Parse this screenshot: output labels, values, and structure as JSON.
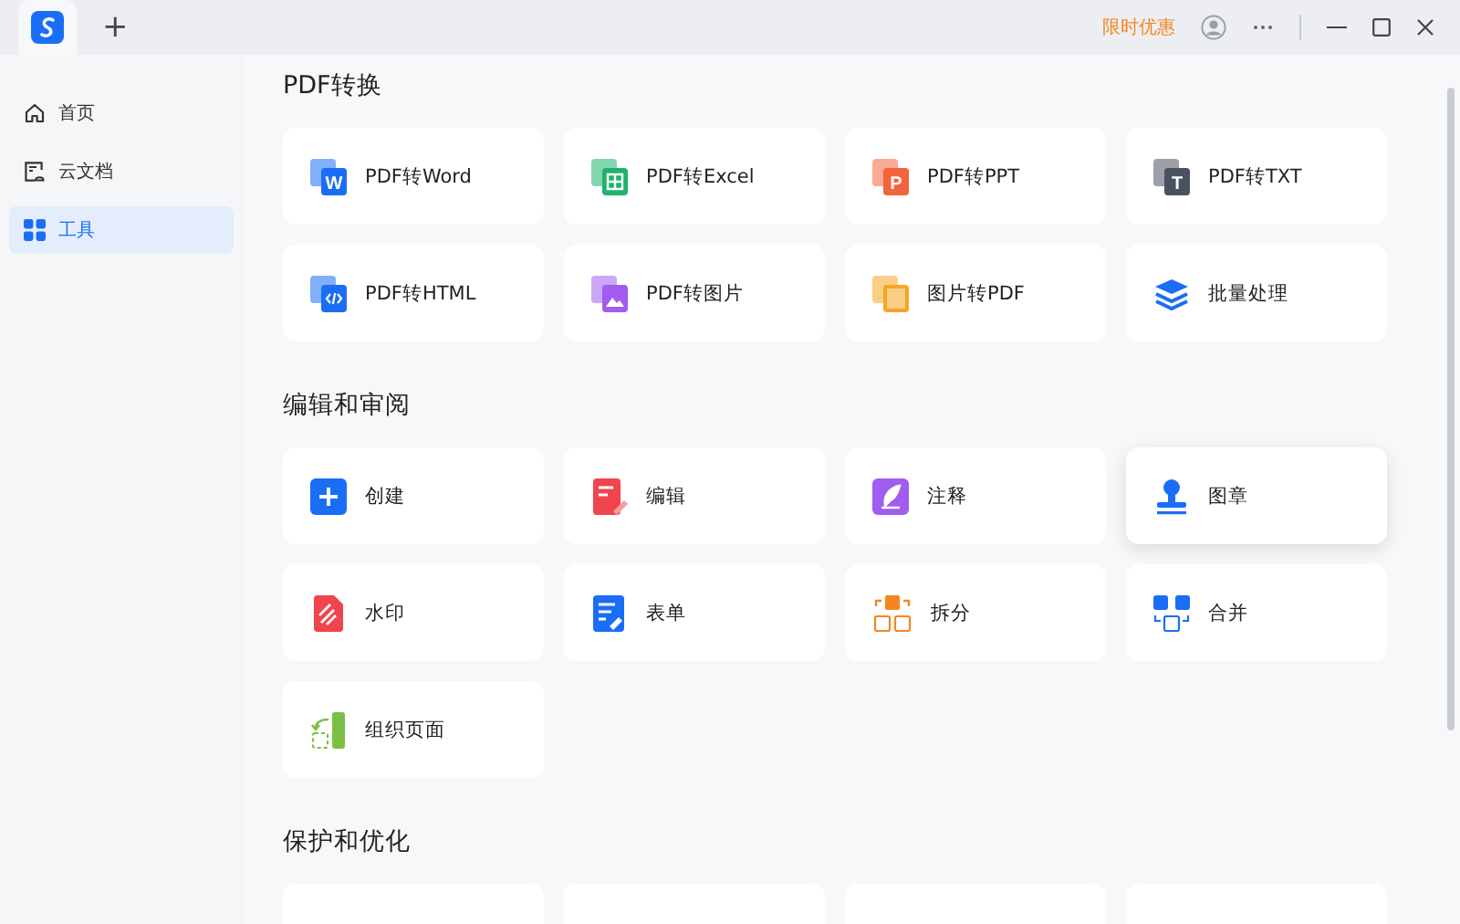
{
  "titlebar": {
    "promo": "限时优惠",
    "add_tab": "+"
  },
  "sidebar": {
    "items": [
      {
        "label": "首页",
        "kind": "home",
        "selected": false
      },
      {
        "label": "云文档",
        "kind": "cloud",
        "selected": false
      },
      {
        "label": "工具",
        "kind": "tools",
        "selected": true
      }
    ]
  },
  "sections": [
    {
      "title": "PDF转换",
      "tools": [
        {
          "label": "PDF转Word",
          "kind": "word",
          "icon_letter": "W",
          "hovered": false
        },
        {
          "label": "PDF转Excel",
          "kind": "excel",
          "hovered": false
        },
        {
          "label": "PDF转PPT",
          "kind": "ppt",
          "icon_letter": "P",
          "hovered": false
        },
        {
          "label": "PDF转TXT",
          "kind": "txt",
          "icon_letter": "T",
          "hovered": false
        },
        {
          "label": "PDF转HTML",
          "kind": "html",
          "hovered": false
        },
        {
          "label": "PDF转图片",
          "kind": "image",
          "hovered": false
        },
        {
          "label": "图片转PDF",
          "kind": "img2pdf",
          "hovered": false
        },
        {
          "label": "批量处理",
          "kind": "batch",
          "hovered": false
        }
      ]
    },
    {
      "title": "编辑和审阅",
      "tools": [
        {
          "label": "创建",
          "kind": "create",
          "hovered": false
        },
        {
          "label": "编辑",
          "kind": "edit",
          "hovered": false
        },
        {
          "label": "注释",
          "kind": "annotate",
          "hovered": false
        },
        {
          "label": "图章",
          "kind": "stamp",
          "hovered": true
        },
        {
          "label": "水印",
          "kind": "watermark",
          "hovered": false
        },
        {
          "label": "表单",
          "kind": "form",
          "hovered": false
        },
        {
          "label": "拆分",
          "kind": "split",
          "hovered": false
        },
        {
          "label": "合并",
          "kind": "merge",
          "hovered": false
        },
        {
          "label": "组织页面",
          "kind": "organize",
          "hovered": false
        }
      ]
    },
    {
      "title": "保护和优化"
    }
  ]
}
